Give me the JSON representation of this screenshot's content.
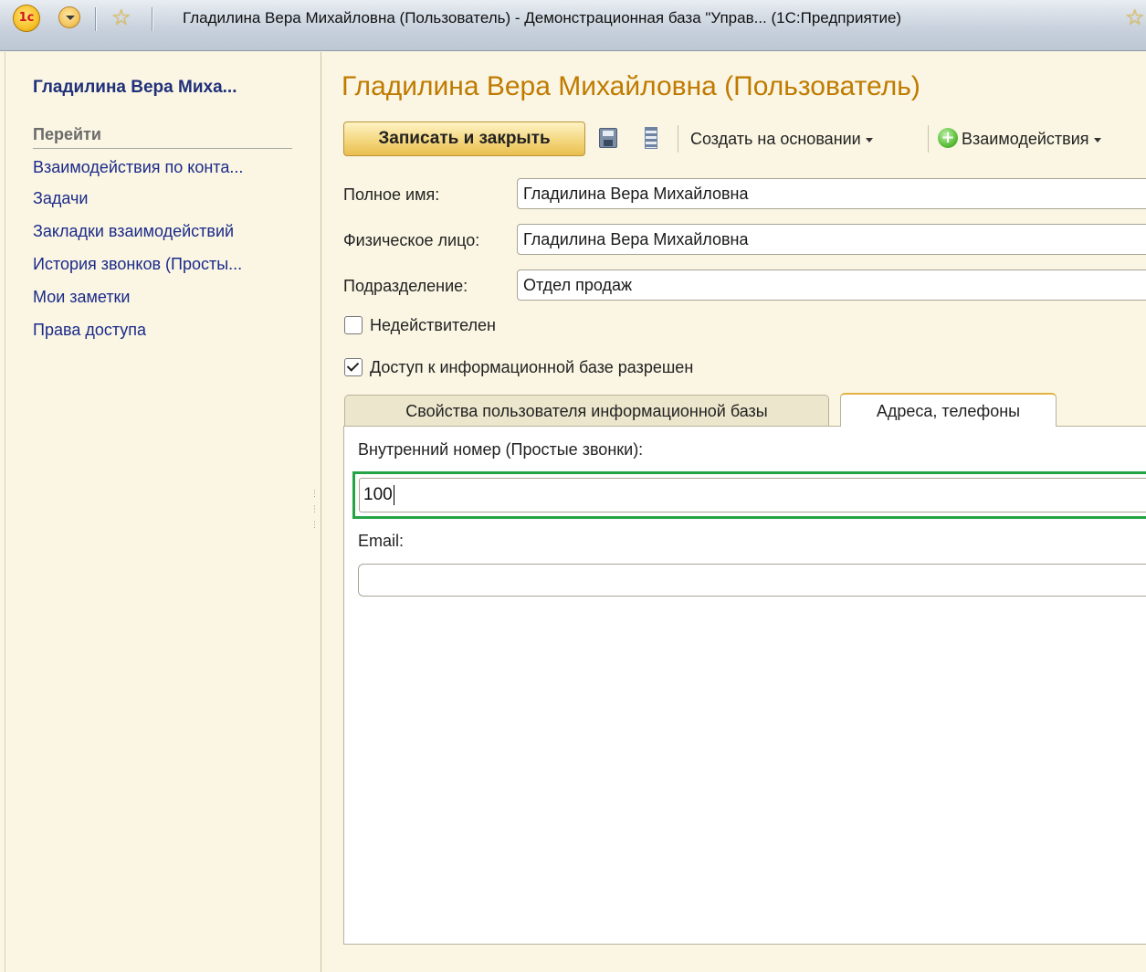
{
  "window": {
    "logo_text": "1с",
    "title": "Гладилина Вера Михайловна (Пользователь) - Демонстрационная база \"Управ... (1С:Предприятие)"
  },
  "nav": {
    "title": "Гладилина Вера Миха...",
    "section": "Перейти",
    "links": [
      "Взаимодействия по конта...",
      "Задачи",
      "Закладки взаимодействий",
      "История звонков (Просты...",
      "Мои заметки",
      "Права доступа"
    ]
  },
  "form": {
    "title": "Гладилина Вера Михайловна (Пользователь)",
    "toolbar": {
      "save_close": "Записать и закрыть",
      "create_based_on": "Создать на основании",
      "interactions": "Взаимодействия"
    },
    "fields": {
      "full_name_label": "Полное имя:",
      "full_name_value": "Гладилина Вера Михайловна",
      "person_label": "Физическое лицо:",
      "person_value": "Гладилина Вера Михайловна",
      "department_label": "Подразделение:",
      "department_value": "Отдел продаж"
    },
    "checkboxes": {
      "inactive_label": "Недействителен",
      "inactive_checked": false,
      "access_label": "Доступ к информационной базе разрешен",
      "access_checked": true
    },
    "tabs": {
      "ib_user_props": "Свойства пользователя информационной базы",
      "addresses_phones": "Адреса, телефоны",
      "active": "addresses_phones"
    },
    "contacts": {
      "internal_number_label": "Внутренний номер (Простые звонки):",
      "internal_number_value": "100",
      "email_label": "Email:",
      "email_value": ""
    }
  },
  "colors": {
    "title_accent": "#c07a00",
    "nav_link": "#1b2a8a",
    "highlight_border": "#24a444"
  }
}
